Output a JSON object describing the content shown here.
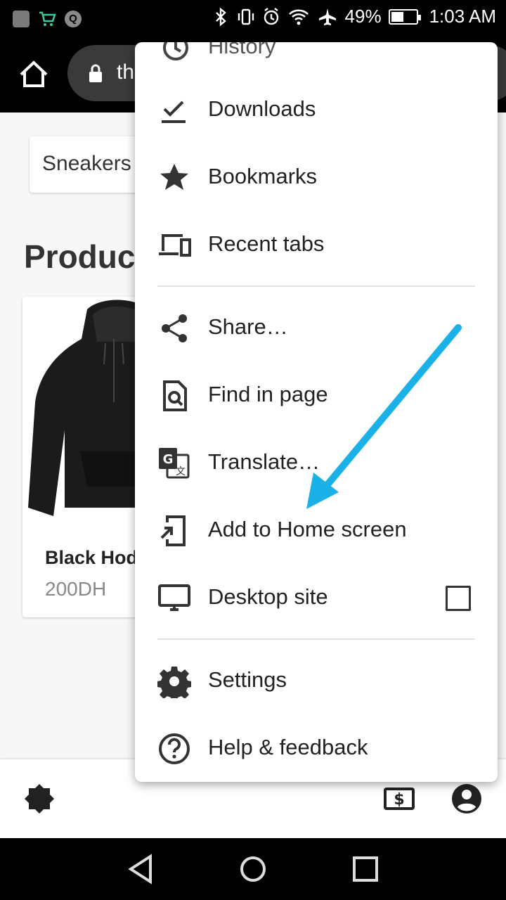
{
  "status_bar": {
    "notification_icons": [
      "image-icon",
      "cart-icon",
      "q-app-icon"
    ],
    "q_letter": "Q",
    "status_icons": [
      "bluetooth-icon",
      "vibrate-icon",
      "alarm-icon",
      "wifi-icon",
      "airplane-icon"
    ],
    "battery_percent": "49%",
    "battery_level": 0.49,
    "time": "1:03 AM"
  },
  "toolbar": {
    "url_text": "th"
  },
  "page": {
    "search_text": "Sneakers",
    "heading": "Product",
    "product": {
      "name": "Black Hod",
      "price": "200DH"
    }
  },
  "menu": {
    "history": "History",
    "downloads": "Downloads",
    "bookmarks": "Bookmarks",
    "recent_tabs": "Recent tabs",
    "share": "Share…",
    "find_in_page": "Find in page",
    "translate": "Translate…",
    "add_to_home": "Add to Home screen",
    "desktop_site": "Desktop site",
    "desktop_site_checked": false,
    "settings": "Settings",
    "help": "Help & feedback"
  },
  "colors": {
    "annotation_arrow": "#1ab0e8",
    "fab": "#f8d0d4"
  }
}
